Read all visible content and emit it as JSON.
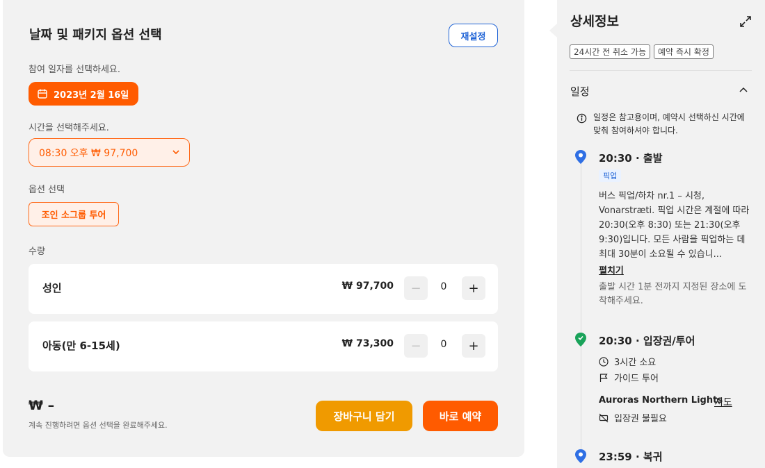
{
  "booking": {
    "title": "날짜 및 패키지 옵션 선택",
    "reset_label": "재설정",
    "date_prompt": "참여 일자를 선택하세요.",
    "date_value": "2023년 2월 16일",
    "time_prompt": "시간을 선택해주세요.",
    "time_value": "08:30 오후 ₩ 97,700",
    "option_prompt": "옵션 선택",
    "option_value": "조인 소그룹 투어",
    "quantity_label": "수량",
    "rows": [
      {
        "name": "성인",
        "price": "₩ 97,700",
        "count": "0"
      },
      {
        "name": "아동(만 6-15세)",
        "price": "₩ 73,300",
        "count": "0"
      }
    ],
    "total": "₩ –",
    "total_note": "계속 진행하려면 옵션 선택을 완료해주세요.",
    "cart_label": "장바구니 담기",
    "book_label": "바로 예약"
  },
  "details": {
    "title": "상세정보",
    "tags": [
      "24시간 전 취소 가능",
      "예약 즉시 확정"
    ],
    "schedule_title": "일정",
    "schedule_notice": "일정은 참고용이며, 예약시 선택하신 시간에 맞춰 참여하셔야 합니다.",
    "steps": [
      {
        "time_title": "20:30 · 출발",
        "badge": "픽업",
        "desc": "버스 픽업/하차 nr.1 – 시청, Vonarstræti. 픽업 시간은 계절에 따라 20:30(오후 8:30) 또는 21:30(오후 9:30)입니다. 모든 사람을 픽업하는 데 최대 30분이 소요될 수 있습니...",
        "more": "펼치기",
        "note": "출발 시간 1분 전까지 지정된 장소에 도착해주세요."
      },
      {
        "time_title": "20:30 · 입장권/투어",
        "duration": "3시간 소요",
        "type": "가이드 투어",
        "place": "Auroras Northern Lights",
        "map": "지도",
        "ticket": "입장권 불필요"
      },
      {
        "time_title": "23:59 · 복귀"
      }
    ]
  },
  "colors": {
    "primary_orange": "#ff5b00",
    "cart_orange": "#f09a00",
    "link_blue": "#1f63d6",
    "pin_blue": "#2f6fe4",
    "pin_green": "#1aa35a"
  }
}
